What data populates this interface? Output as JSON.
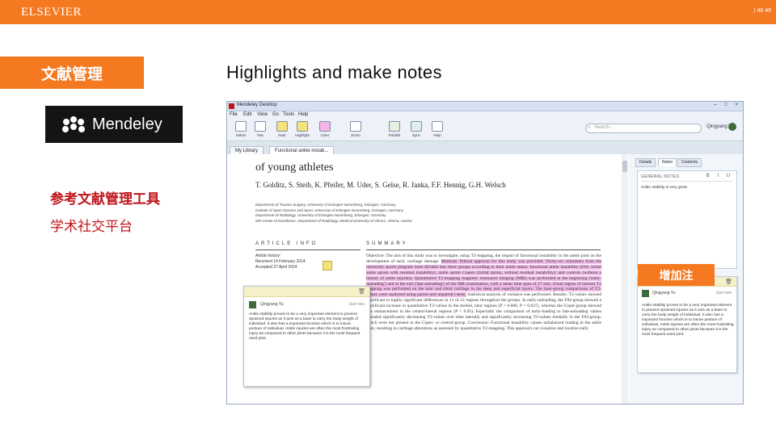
{
  "header": {
    "publisher": "ELSEVIER",
    "page_number": "| 46   46"
  },
  "sidebar": {
    "section_tab": "文献管理",
    "brand_logo": "Mendeley",
    "line1": "参考文献管理工具",
    "line2": "学术社交平台"
  },
  "slide_title": "Highlights and make notes",
  "callout": "增加注",
  "app": {
    "window_title": "Mendeley Desktop",
    "window_controls": "– □ ×",
    "menu": [
      "File",
      "Edit",
      "View",
      "Go",
      "Tools",
      "Help"
    ],
    "toolbar": [
      {
        "label": "Select",
        "icon": "select-cursor-icon"
      },
      {
        "label": "Pan",
        "icon": "pan-hand-icon"
      },
      {
        "label": "Note",
        "icon": "note-icon"
      },
      {
        "label": "Highlight",
        "icon": "highlight-icon"
      },
      {
        "label": "Color",
        "icon": "color-icon"
      },
      {
        "label": "Zoom",
        "icon": "zoom-icon"
      },
      {
        "label": "Publish",
        "icon": "publish-icon"
      },
      {
        "label": "Sync",
        "icon": "sync-icon"
      },
      {
        "label": "Help",
        "icon": "help-icon"
      }
    ],
    "search_placeholder": "Search...",
    "user_name": "Qingyang Yu",
    "tabs": [
      "My Library",
      "Functional ankle instab..."
    ]
  },
  "pdf": {
    "title_fragment": "of young athletes",
    "authors": "T. Golditz, S. Steib, K. Pfeifer, M. Uder, S. Gelse, R. Janka, F.F. Hennig, G.H. Welsch",
    "affiliations": [
      "Department of Trauma Surgery, University of Erlangen-Nuremberg, Erlangen, Germany",
      "Institute of Sport Science and Sport, University of Erlangen-Nuremberg, Erlangen, Germany",
      "Department of Radiology, University of Erlangen-Nuremberg, Erlangen, Germany",
      "MR Center of Excellence, Department of Radiology, Medical University of Vienna, Vienna, Austria"
    ],
    "article_info_header": "ARTICLE INFO",
    "summary_header": "SUMMARY",
    "history_label": "Article history:",
    "history_received": "Received 14 February 2014",
    "history_accepted": "Accepted 27 April 2014",
    "summary_plain_1": "Objective: The aim of this study was to investigate, using T2-mapping, the impact of functional instability in the ankle joint on the development of early cartilage damage.",
    "summary_highlight": "Methods: Ethical approval for this study was provided. Thirty-six volunteers from the university sports program were divided into three groups according to their ankle status: functional ankle instability (FAI; initial ankle sprain with residual instability); ankle sprain Copers (initial sprain, without residual instability); and controls (without a history of ankle injuries). Quantitative T2-mapping magnetic resonance imaging (MRI) was performed at the beginning ('early-unloading') and at the end ('late-unloading') of the MR examination, with a mean time span of 27 min. Zonal region of interest T2 mapping was performed on the talar and tibial cartilage in the deep and superficial layers. The inter-group comparisons of T2-values were analyzed using paired and unpaired t-tests.",
    "summary_plain_2": "Statistical analysis of variance was performed. Results: T2-values showed significant to highly significant differences in 11 of 12 regions throughout the groups. In early-unloading, the FAI-group showed a significant increase in quantitative T2-values in the medial, talar regions (P = 0.008, P = 0.027), whereas the Coper-group showed this enhancement in the central-lateral regions (P = 0.05). Especially the comparison of early-loading to late-unloading values revealed significantly decreasing T2-values over time laterally and significantly increasing T2-values medially in the FAI-group, which were not present in the Coper- or control-group. Conclusion: Functional instability causes unbalanced loading in the ankle joint, resulting in cartilage alterations as assessed by quantitative T2-mapping. This approach can visualize and localize early"
  },
  "note_popup": {
    "user": "Qingyang Yu",
    "time": "Just now",
    "text": "Ankle stability proves to be a very important element to prevent sprained injuries as it acts as a base to carry the body weight of individual. It also has a important function which is to insure posture of individual. Ankle injuries are often the most frustrating injury as compared to other joints because it is the most frequent used joint."
  },
  "right_panel": {
    "tabs": [
      "Details",
      "Notes",
      "Contents"
    ],
    "general_notes_header": "GENERAL NOTES",
    "format_buttons": "B I U",
    "general_notes_text": "Ankle stability is very great",
    "note_user": "Qingyang Yu",
    "note_time": "Just now",
    "note_text": "Ankle stability proves to be a very important element to prevent sprained injuries as it acts as a base to carry the body weight of individual. It also has a important function which is to insure posture of individual. Ankle injuries are often the most frustrating injury as compared to other joints because it is the most frequent used joint."
  },
  "colors": {
    "brand_orange": "#f47920",
    "accent_red": "#c0141b",
    "highlight_pink": "#f1bde8"
  }
}
